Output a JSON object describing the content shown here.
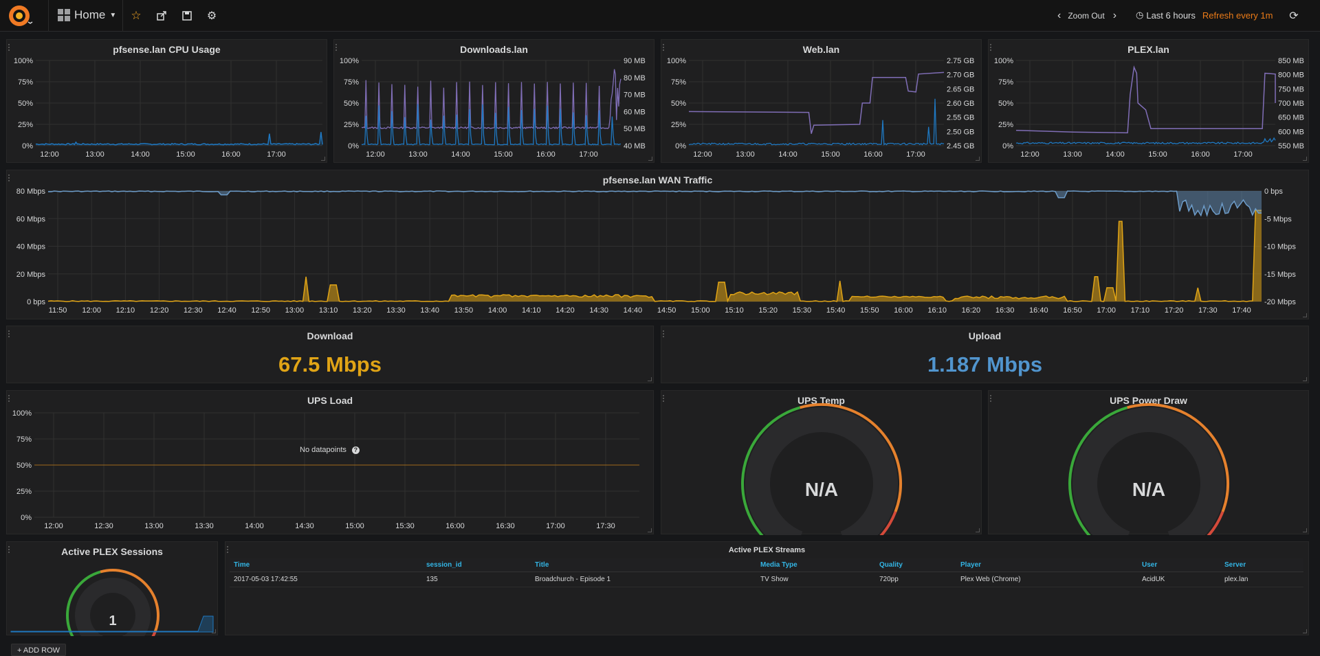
{
  "nav": {
    "dashboard_title": "Home",
    "zoom_out": "Zoom Out",
    "time_range": "Last 6 hours",
    "refresh": "Refresh every 1m"
  },
  "panels": {
    "cpu": {
      "title": "pfsense.lan CPU Usage",
      "y_ticks": [
        "100%",
        "75%",
        "50%",
        "25%",
        "0%"
      ],
      "x_ticks": [
        "12:00",
        "13:00",
        "14:00",
        "15:00",
        "16:00",
        "17:00"
      ]
    },
    "downloads": {
      "title": "Downloads.lan",
      "y_ticks": [
        "100%",
        "75%",
        "50%",
        "25%",
        "0%"
      ],
      "y2_ticks": [
        "90 MB",
        "80 MB",
        "70 MB",
        "60 MB",
        "50 MB",
        "40 MB"
      ],
      "x_ticks": [
        "12:00",
        "13:00",
        "14:00",
        "15:00",
        "16:00",
        "17:00"
      ]
    },
    "web": {
      "title": "Web.lan",
      "y_ticks": [
        "100%",
        "75%",
        "50%",
        "25%",
        "0%"
      ],
      "y2_ticks": [
        "2.75 GB",
        "2.70 GB",
        "2.65 GB",
        "2.60 GB",
        "2.55 GB",
        "2.50 GB",
        "2.45 GB"
      ],
      "x_ticks": [
        "12:00",
        "13:00",
        "14:00",
        "15:00",
        "16:00",
        "17:00"
      ]
    },
    "plex": {
      "title": "PLEX.lan",
      "y_ticks": [
        "100%",
        "75%",
        "50%",
        "25%",
        "0%"
      ],
      "y2_ticks": [
        "850 MB",
        "800 MB",
        "750 MB",
        "700 MB",
        "650 MB",
        "600 MB",
        "550 MB"
      ],
      "x_ticks": [
        "12:00",
        "13:00",
        "14:00",
        "15:00",
        "16:00",
        "17:00"
      ]
    },
    "wan": {
      "title": "pfsense.lan WAN Traffic",
      "y_ticks": [
        "80 Mbps",
        "60 Mbps",
        "40 Mbps",
        "20 Mbps",
        "0 bps"
      ],
      "y2_ticks": [
        "0 bps",
        "-5 Mbps",
        "-10 Mbps",
        "-15 Mbps",
        "-20 Mbps"
      ],
      "x_ticks": [
        "11:50",
        "12:00",
        "12:10",
        "12:20",
        "12:30",
        "12:40",
        "12:50",
        "13:00",
        "13:10",
        "13:20",
        "13:30",
        "13:40",
        "13:50",
        "14:00",
        "14:10",
        "14:20",
        "14:30",
        "14:40",
        "14:50",
        "15:00",
        "15:10",
        "15:20",
        "15:30",
        "15:40",
        "15:50",
        "16:00",
        "16:10",
        "16:20",
        "16:30",
        "16:40",
        "16:50",
        "17:00",
        "17:10",
        "17:20",
        "17:30",
        "17:40"
      ]
    },
    "download": {
      "title": "Download",
      "value": "67.5 Mbps",
      "color": "#e0a416"
    },
    "upload": {
      "title": "Upload",
      "value": "1.187 Mbps",
      "color": "#5195ce"
    },
    "ups_load": {
      "title": "UPS Load",
      "no_data": "No datapoints",
      "y_ticks": [
        "100%",
        "75%",
        "50%",
        "25%",
        "0%"
      ],
      "x_ticks": [
        "12:00",
        "12:30",
        "13:00",
        "13:30",
        "14:00",
        "14:30",
        "15:00",
        "15:30",
        "16:00",
        "16:30",
        "17:00",
        "17:30"
      ]
    },
    "ups_temp": {
      "title": "UPS Temp",
      "value": "N/A"
    },
    "ups_power": {
      "title": "UPS Power Draw",
      "value": "N/A"
    },
    "plex_sessions": {
      "title": "Active PLEX Sessions",
      "value": "1"
    },
    "streams": {
      "title": "Active PLEX Streams",
      "columns": [
        "Time",
        "session_id",
        "Title",
        "Media Type",
        "Quality",
        "Player",
        "User",
        "Server"
      ],
      "rows": [
        [
          "2017-05-03 17:42:55",
          "135",
          "Broadchurch - Episode 1",
          "TV Show",
          "720pp",
          "Plex Web (Chrome)",
          "AcidUK",
          "plex.lan"
        ]
      ]
    }
  },
  "add_row": "ADD ROW",
  "colors": {
    "blue": "#1f78c1",
    "purple": "#806eb7",
    "yellow": "#e0a416",
    "lightblue": "#6d9cc9",
    "green": "#3aa83a",
    "orange": "#e5812d",
    "red": "#d44a3a"
  }
}
